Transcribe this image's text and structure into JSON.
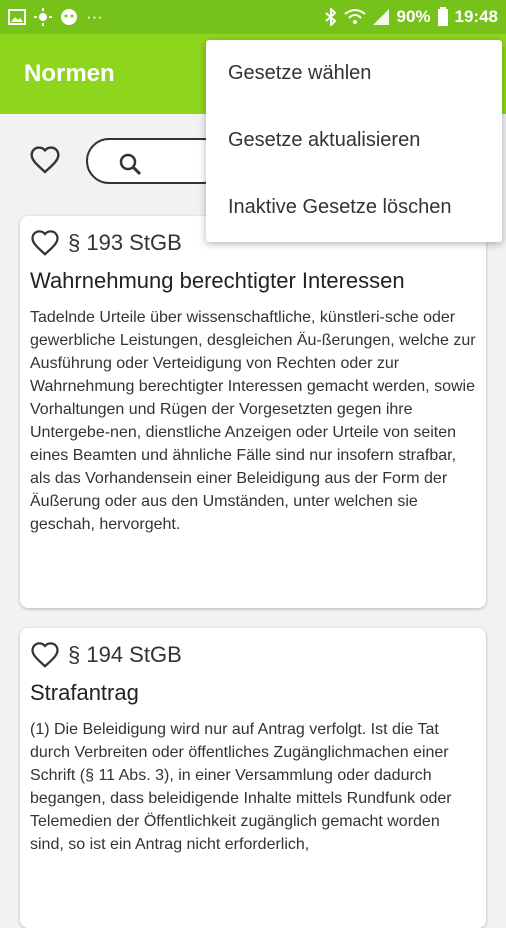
{
  "status": {
    "battery": "90%",
    "time": "19:48",
    "more": "···"
  },
  "toolbar": {
    "title": "Normen"
  },
  "search": {
    "placeholder": ""
  },
  "menu": {
    "items": [
      "Gesetze wählen",
      "Gesetze aktualisieren",
      "Inaktive Gesetze löschen"
    ]
  },
  "cards": [
    {
      "section": "§ 193 StGB",
      "title": "Wahrnehmung berechtigter Interessen",
      "text": "Tadelnde Urteile über wissenschaftliche, künstleri-sche oder gewerbliche Leistungen, desgleichen Äu-ßerungen, welche zur Ausführung oder Verteidigung von Rechten oder zur Wahrnehmung berechtigter Interessen gemacht werden, sowie Vorhaltungen und Rügen der Vorgesetzten gegen ihre Untergebe-nen, dienstliche Anzeigen oder Urteile von seiten eines Beamten und ähnliche Fälle sind nur insofern strafbar, als das Vorhandensein einer Beleidigung aus der Form der Äußerung oder aus den Umständen, unter welchen sie geschah, hervorgeht."
    },
    {
      "section": "§ 194 StGB",
      "title": "Strafantrag",
      "text": "(1) Die Beleidigung wird nur auf Antrag verfolgt. Ist die Tat durch Verbreiten oder öffentliches Zugänglichmachen einer Schrift (§ 11 Abs. 3), in einer Versammlung oder dadurch begangen, dass beleidigende Inhalte mittels Rundfunk oder Telemedien der Öffentlichkeit zugänglich gemacht worden sind, so ist ein Antrag nicht erforderlich,"
    }
  ]
}
